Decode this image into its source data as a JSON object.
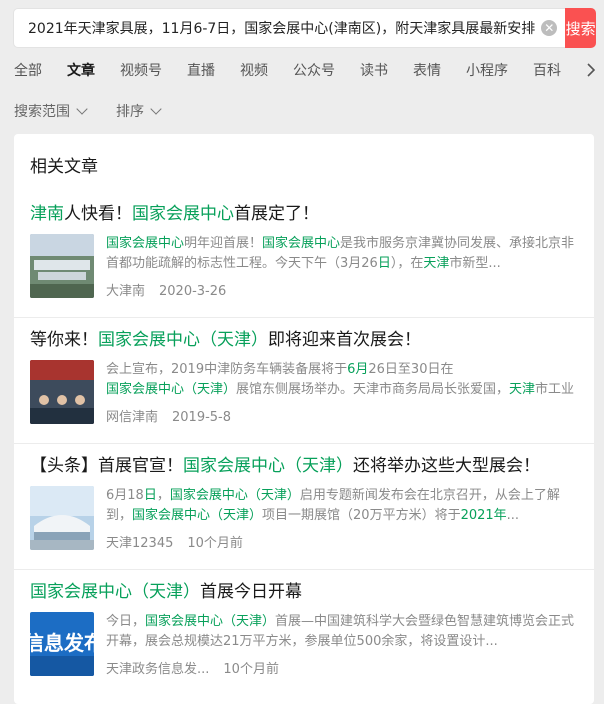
{
  "search": {
    "query": "2021年天津家具展，11月6-7日，国家会展中心(津南区)，附天津家具展最新安排",
    "button_label": "搜索",
    "clear_icon": "close-circle-icon"
  },
  "tabs": [
    {
      "label": "全部",
      "active": false
    },
    {
      "label": "文章",
      "active": true
    },
    {
      "label": "视频号",
      "active": false
    },
    {
      "label": "直播",
      "active": false
    },
    {
      "label": "视频",
      "active": false
    },
    {
      "label": "公众号",
      "active": false
    },
    {
      "label": "读书",
      "active": false
    },
    {
      "label": "表情",
      "active": false
    },
    {
      "label": "小程序",
      "active": false
    },
    {
      "label": "百科",
      "active": false
    }
  ],
  "filters": {
    "scope_label": "搜索范围",
    "sort_label": "排序"
  },
  "section_title": "相关文章",
  "accent_color": "#07a05a",
  "articles": [
    {
      "title_parts": [
        {
          "t": "津南",
          "hl": true
        },
        {
          "t": "人快看！",
          "hl": false
        },
        {
          "t": "国家会展中心",
          "hl": true
        },
        {
          "t": "首展定了！",
          "hl": false
        }
      ],
      "desc_parts": [
        {
          "t": "国家会展中心",
          "hl": true
        },
        {
          "t": "明年迎首展！",
          "hl": false
        },
        {
          "t": "国家会展中心",
          "hl": true
        },
        {
          "t": "是我市服务京津冀协同发展、承接北京非首都功能疏解的标志性工程。今天下午（3月26",
          "hl": false
        },
        {
          "t": "日",
          "hl": true
        },
        {
          "t": "），在",
          "hl": false
        },
        {
          "t": "天津",
          "hl": true
        },
        {
          "t": "市新型...",
          "hl": false
        }
      ],
      "source": "大津南",
      "date": "2020-3-26",
      "thumb": "aerial-photo"
    },
    {
      "title_parts": [
        {
          "t": "等你来！",
          "hl": false
        },
        {
          "t": "国家会展中心（天津）",
          "hl": true
        },
        {
          "t": "即将迎来首次展会！",
          "hl": false
        }
      ],
      "desc_parts": [
        {
          "t": "会上宣布，2019中津防务车辆装备展将于",
          "hl": false
        },
        {
          "t": "6月",
          "hl": true
        },
        {
          "t": "26日至30日在",
          "hl": false
        },
        {
          "t": "国家会展中心（天津）",
          "hl": true
        },
        {
          "t": "展馆东侧展场举办。天津市商务局局长张爱国，",
          "hl": false
        },
        {
          "t": "天津",
          "hl": true
        },
        {
          "t": "市工业和信...",
          "hl": false
        }
      ],
      "source": "网信津南",
      "date": "2019-5-8",
      "thumb": "meeting-photo"
    },
    {
      "title_parts": [
        {
          "t": "【头条】首展官宣！",
          "hl": false
        },
        {
          "t": "国家会展中心（天津）",
          "hl": true
        },
        {
          "t": "还将举办这些大型展会！",
          "hl": false
        }
      ],
      "desc_parts": [
        {
          "t": "6月18",
          "hl": false
        },
        {
          "t": "日",
          "hl": true
        },
        {
          "t": "，",
          "hl": false
        },
        {
          "t": "国家会展中心（天津）",
          "hl": true
        },
        {
          "t": "启用专题新闻发布会在北京召开，从会上了解到，",
          "hl": false
        },
        {
          "t": "国家会展中心（天津）",
          "hl": true
        },
        {
          "t": "项目一期展馆（20万平方米）将于",
          "hl": false
        },
        {
          "t": "2021年",
          "hl": true
        },
        {
          "t": "...",
          "hl": false
        }
      ],
      "source": "天津12345",
      "date": "10个月前",
      "thumb": "building-render"
    },
    {
      "title_parts": [
        {
          "t": "国家会展中心（天津）",
          "hl": true
        },
        {
          "t": "首展今日开幕",
          "hl": false
        }
      ],
      "desc_parts": [
        {
          "t": "今日，",
          "hl": false
        },
        {
          "t": "国家会展中心（天津）",
          "hl": true
        },
        {
          "t": "首展—中国建筑科学大会暨绿色智慧建筑博览会正式开幕，展会总规模达21万平方米，参展单位500余家，将设置设计...",
          "hl": false
        }
      ],
      "source": "天津政务信息发...",
      "date": "10个月前",
      "thumb": "blue-banner",
      "thumb_text": "信息发布"
    }
  ]
}
